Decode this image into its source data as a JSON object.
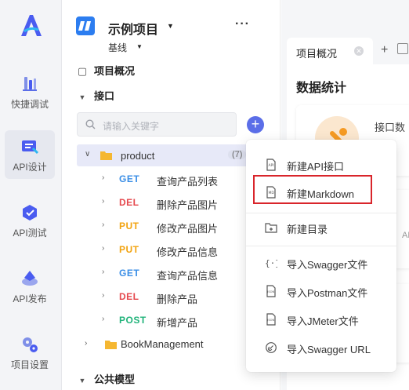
{
  "rail": {
    "items": [
      {
        "label": "快捷调试"
      },
      {
        "label": "API设计"
      },
      {
        "label": "API测试"
      },
      {
        "label": "API发布"
      },
      {
        "label": "项目设置"
      }
    ]
  },
  "project": {
    "title": "示例项目",
    "branch": "基线",
    "more": "···"
  },
  "tree": {
    "overview": "项目概况",
    "interfaces": "接口",
    "public_models": "公共模型",
    "search_placeholder": "请输入关键字",
    "add_symbol": "+",
    "folder": {
      "name": "product",
      "count": "(7)"
    },
    "apis": [
      {
        "method": "GET",
        "name": "查询产品列表",
        "color": "#3a8ee6"
      },
      {
        "method": "DEL",
        "name": "删除产品图片",
        "color": "#e5484d"
      },
      {
        "method": "PUT",
        "name": "修改产品图片",
        "color": "#f2a30f"
      },
      {
        "method": "PUT",
        "name": "修改产品信息",
        "color": "#f2a30f"
      },
      {
        "method": "GET",
        "name": "查询产品信息",
        "color": "#3a8ee6"
      },
      {
        "method": "DEL",
        "name": "删除产品",
        "color": "#e5484d"
      },
      {
        "method": "POST",
        "name": "新增产品",
        "color": "#21b37a"
      }
    ],
    "folder2": {
      "name": "BookManagement"
    }
  },
  "right": {
    "tab_label": "项目概况",
    "tab_close": "✕",
    "tab_add": "+",
    "heading": "数据统计",
    "card_label": "接口数",
    "fragment": "API"
  },
  "menu": {
    "items": [
      {
        "label": "新建API接口",
        "icon": "new-api-icon"
      },
      {
        "label": "新建Markdown",
        "icon": "new-markdown-icon"
      },
      {
        "label": "新建目录",
        "icon": "new-folder-icon"
      },
      {
        "label": "导入Swagger文件",
        "icon": "swagger-file-icon"
      },
      {
        "label": "导入Postman文件",
        "icon": "json-file-icon"
      },
      {
        "label": "导入JMeter文件",
        "icon": "json-file-icon"
      },
      {
        "label": "导入Swagger URL",
        "icon": "link-icon"
      }
    ]
  },
  "colors": {
    "accent": "#5b6ee8",
    "highlight_border": "#d9252b",
    "folder": "#f5b731"
  }
}
